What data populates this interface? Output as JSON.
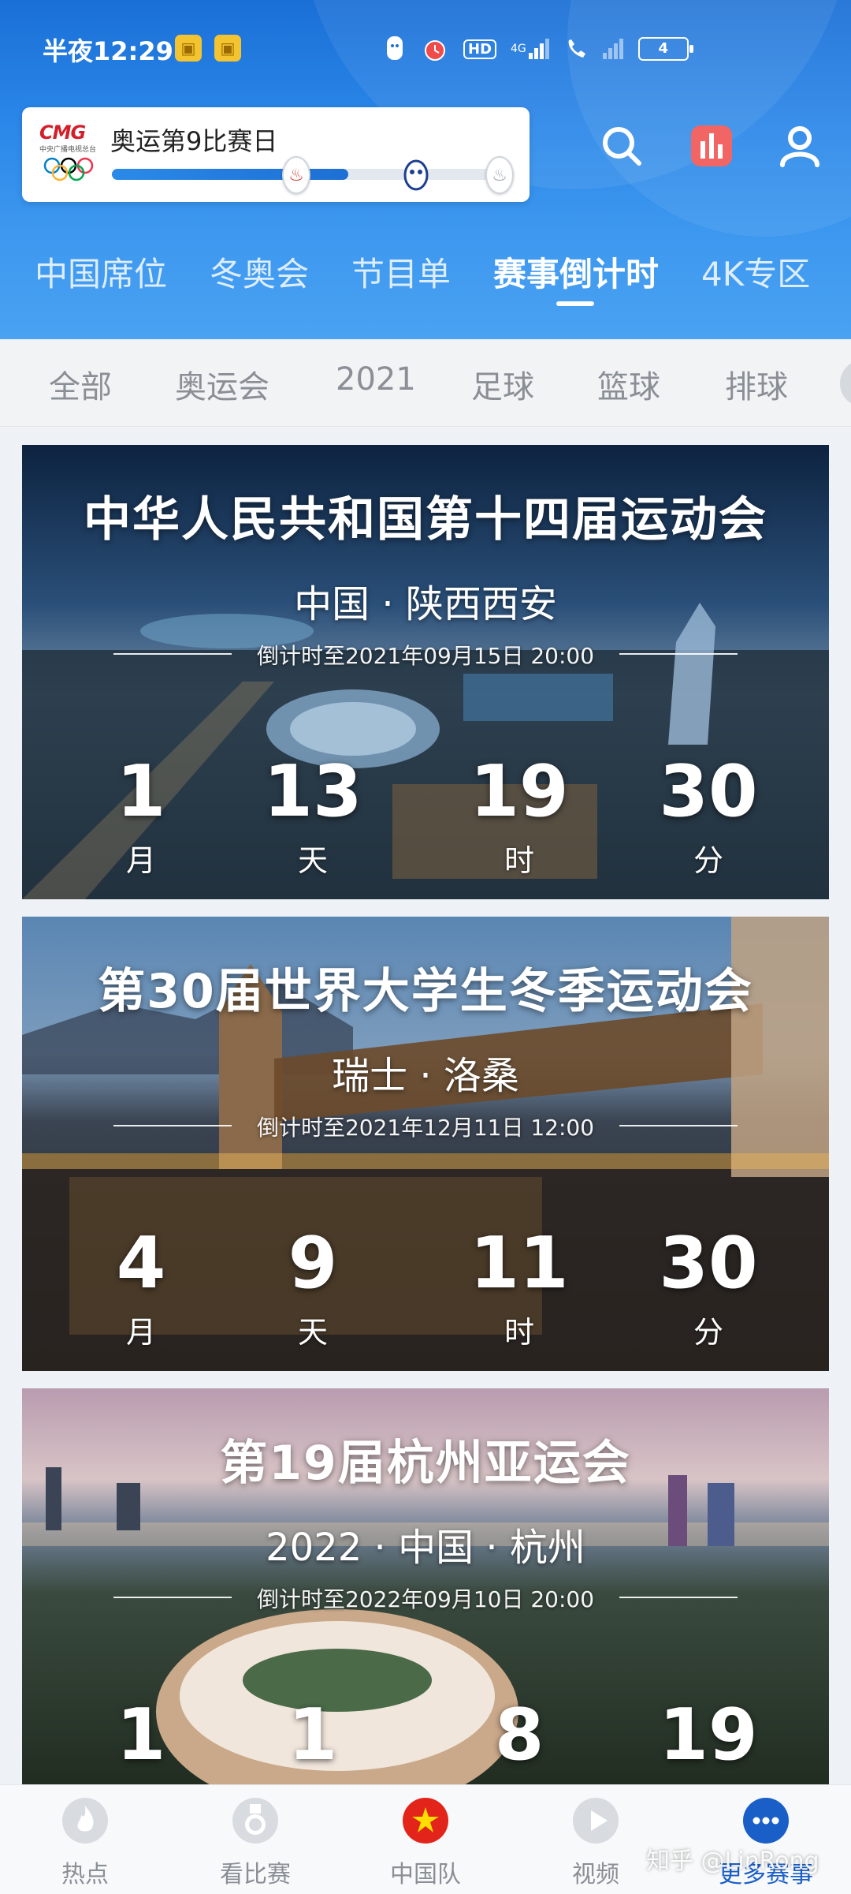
{
  "status_bar": {
    "time": "半夜12:29",
    "network": "4G",
    "hd": "HD",
    "battery": "4"
  },
  "brand": {
    "logo_text": "CMG",
    "logo_subtext": "中央广播电视总台",
    "olympic_day": "奥运第9比赛日",
    "progress_fraction": 0.6
  },
  "header_actions": [
    "search-icon",
    "stats-icon",
    "profile-icon"
  ],
  "top_nav": {
    "items": [
      "中国席位",
      "冬奥会",
      "节目单",
      "赛事倒计时",
      "4K专区"
    ],
    "active": "赛事倒计时"
  },
  "sub_nav": {
    "items": [
      "全部",
      "奥运会",
      "2021",
      "足球",
      "篮球",
      "排球"
    ]
  },
  "events": [
    {
      "title": "中华人民共和国第十四届运动会",
      "location": "中国 · 陕西西安",
      "deadline": "倒计时至2021年09月15日 20:00",
      "countdown": [
        {
          "value": "1",
          "unit": "月"
        },
        {
          "value": "13",
          "unit": "天"
        },
        {
          "value": "19",
          "unit": "时"
        },
        {
          "value": "30",
          "unit": "分"
        }
      ]
    },
    {
      "title": "第30届世界大学生冬季运动会",
      "location": "瑞士 · 洛桑",
      "deadline": "倒计时至2021年12月11日 12:00",
      "countdown": [
        {
          "value": "4",
          "unit": "月"
        },
        {
          "value": "9",
          "unit": "天"
        },
        {
          "value": "11",
          "unit": "时"
        },
        {
          "value": "30",
          "unit": "分"
        }
      ]
    },
    {
      "title": "第19届杭州亚运会",
      "location": "2022 · 中国 · 杭州",
      "deadline": "倒计时至2022年09月10日 20:00",
      "countdown": [
        {
          "value": "1",
          "unit": ""
        },
        {
          "value": "1",
          "unit": ""
        },
        {
          "value": "8",
          "unit": ""
        },
        {
          "value": "19",
          "unit": ""
        }
      ]
    }
  ],
  "tab_bar": {
    "items": [
      {
        "label": "热点",
        "icon": "flame-icon"
      },
      {
        "label": "看比赛",
        "icon": "medal-icon"
      },
      {
        "label": "中国队",
        "icon": "china-flag-icon"
      },
      {
        "label": "视频",
        "icon": "play-icon"
      },
      {
        "label": "更多赛事",
        "icon": "more-icon"
      }
    ],
    "active": "更多赛事"
  },
  "watermark": "知乎 @LinRong",
  "colors": {
    "header_blue": "#2a86e8",
    "active_tab": "#1a5fc8",
    "brand_red": "#d21f2a"
  }
}
